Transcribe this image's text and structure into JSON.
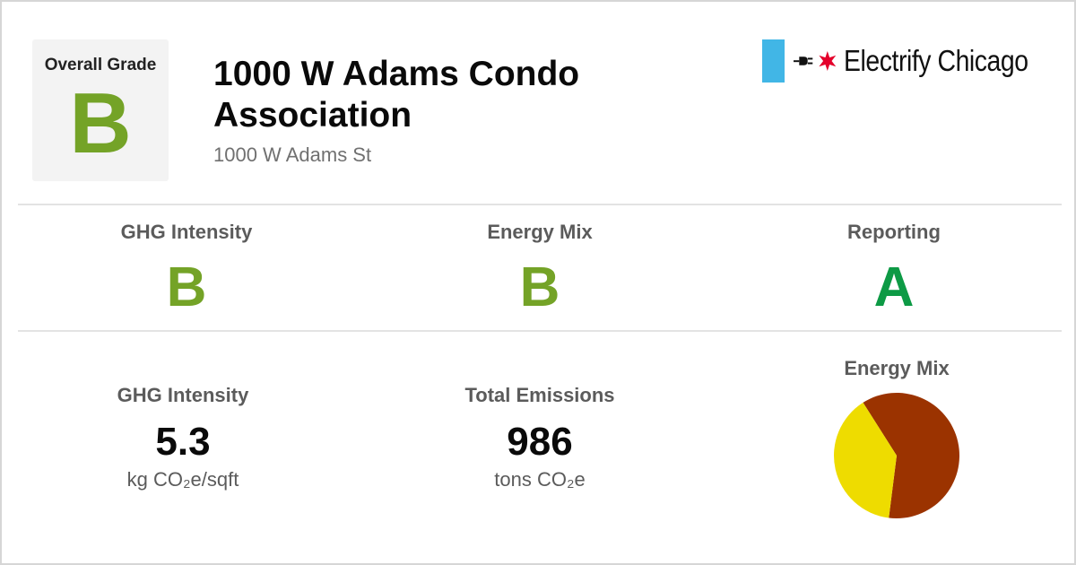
{
  "brand": {
    "name": "Electrify Chicago",
    "colors": {
      "blue": "#41b6e6",
      "star": "#e4002b"
    }
  },
  "overall": {
    "label": "Overall Grade",
    "grade": "B",
    "color": "#74a327"
  },
  "building": {
    "title": "1000 W Adams Condo Association",
    "address": "1000 W Adams St"
  },
  "grades": [
    {
      "label": "GHG Intensity",
      "grade": "B",
      "color": "#74a327"
    },
    {
      "label": "Energy Mix",
      "grade": "B",
      "color": "#74a327"
    },
    {
      "label": "Reporting",
      "grade": "A",
      "color": "#0d9a45"
    }
  ],
  "metrics": {
    "ghg": {
      "label": "GHG Intensity",
      "value": "5.3",
      "unit": "kg CO₂e/sqft"
    },
    "emissions": {
      "label": "Total Emissions",
      "value": "986",
      "unit": "tons CO₂e"
    }
  },
  "energy_mix": {
    "label": "Energy Mix"
  },
  "chart_data": {
    "type": "pie",
    "slices": [
      {
        "value": 61,
        "color": "#9b3300"
      },
      {
        "value": 39,
        "color": "#eedc00"
      }
    ]
  }
}
